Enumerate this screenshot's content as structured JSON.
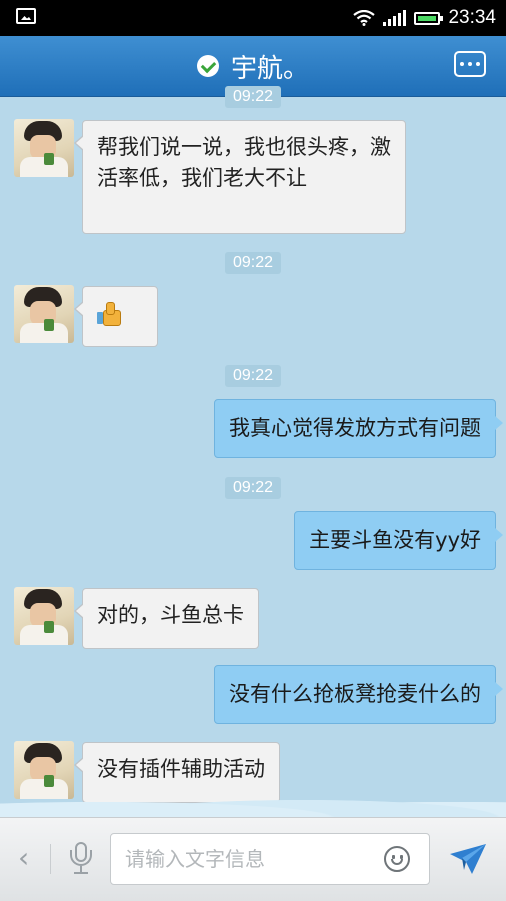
{
  "status_bar": {
    "time": "23:34"
  },
  "header": {
    "title": "宇航。"
  },
  "messages": [
    {
      "type": "timestamp",
      "text": "09:22"
    },
    {
      "type": "incoming",
      "text": "帮我们说一说，我也很头疼，激活率低，我们老大不让"
    },
    {
      "type": "timestamp",
      "text": "09:22"
    },
    {
      "type": "incoming",
      "sticker": "thumbs-up-icon"
    },
    {
      "type": "timestamp",
      "text": "09:22"
    },
    {
      "type": "outgoing",
      "text": "我真心觉得发放方式有问题"
    },
    {
      "type": "timestamp",
      "text": "09:22"
    },
    {
      "type": "outgoing",
      "text": "主要斗鱼没有yy好"
    },
    {
      "type": "incoming",
      "text": "对的，斗鱼总卡"
    },
    {
      "type": "outgoing",
      "text": "没有什么抢板凳抢麦什么的"
    },
    {
      "type": "incoming",
      "text": "没有插件辅助活动"
    }
  ],
  "input": {
    "placeholder": "请输入文字信息"
  },
  "colors": {
    "header": "#2a7cc4",
    "background": "#b7d8ea",
    "outgoing_bubble": "#8fcdf3",
    "incoming_bubble": "#f2f2f2"
  }
}
